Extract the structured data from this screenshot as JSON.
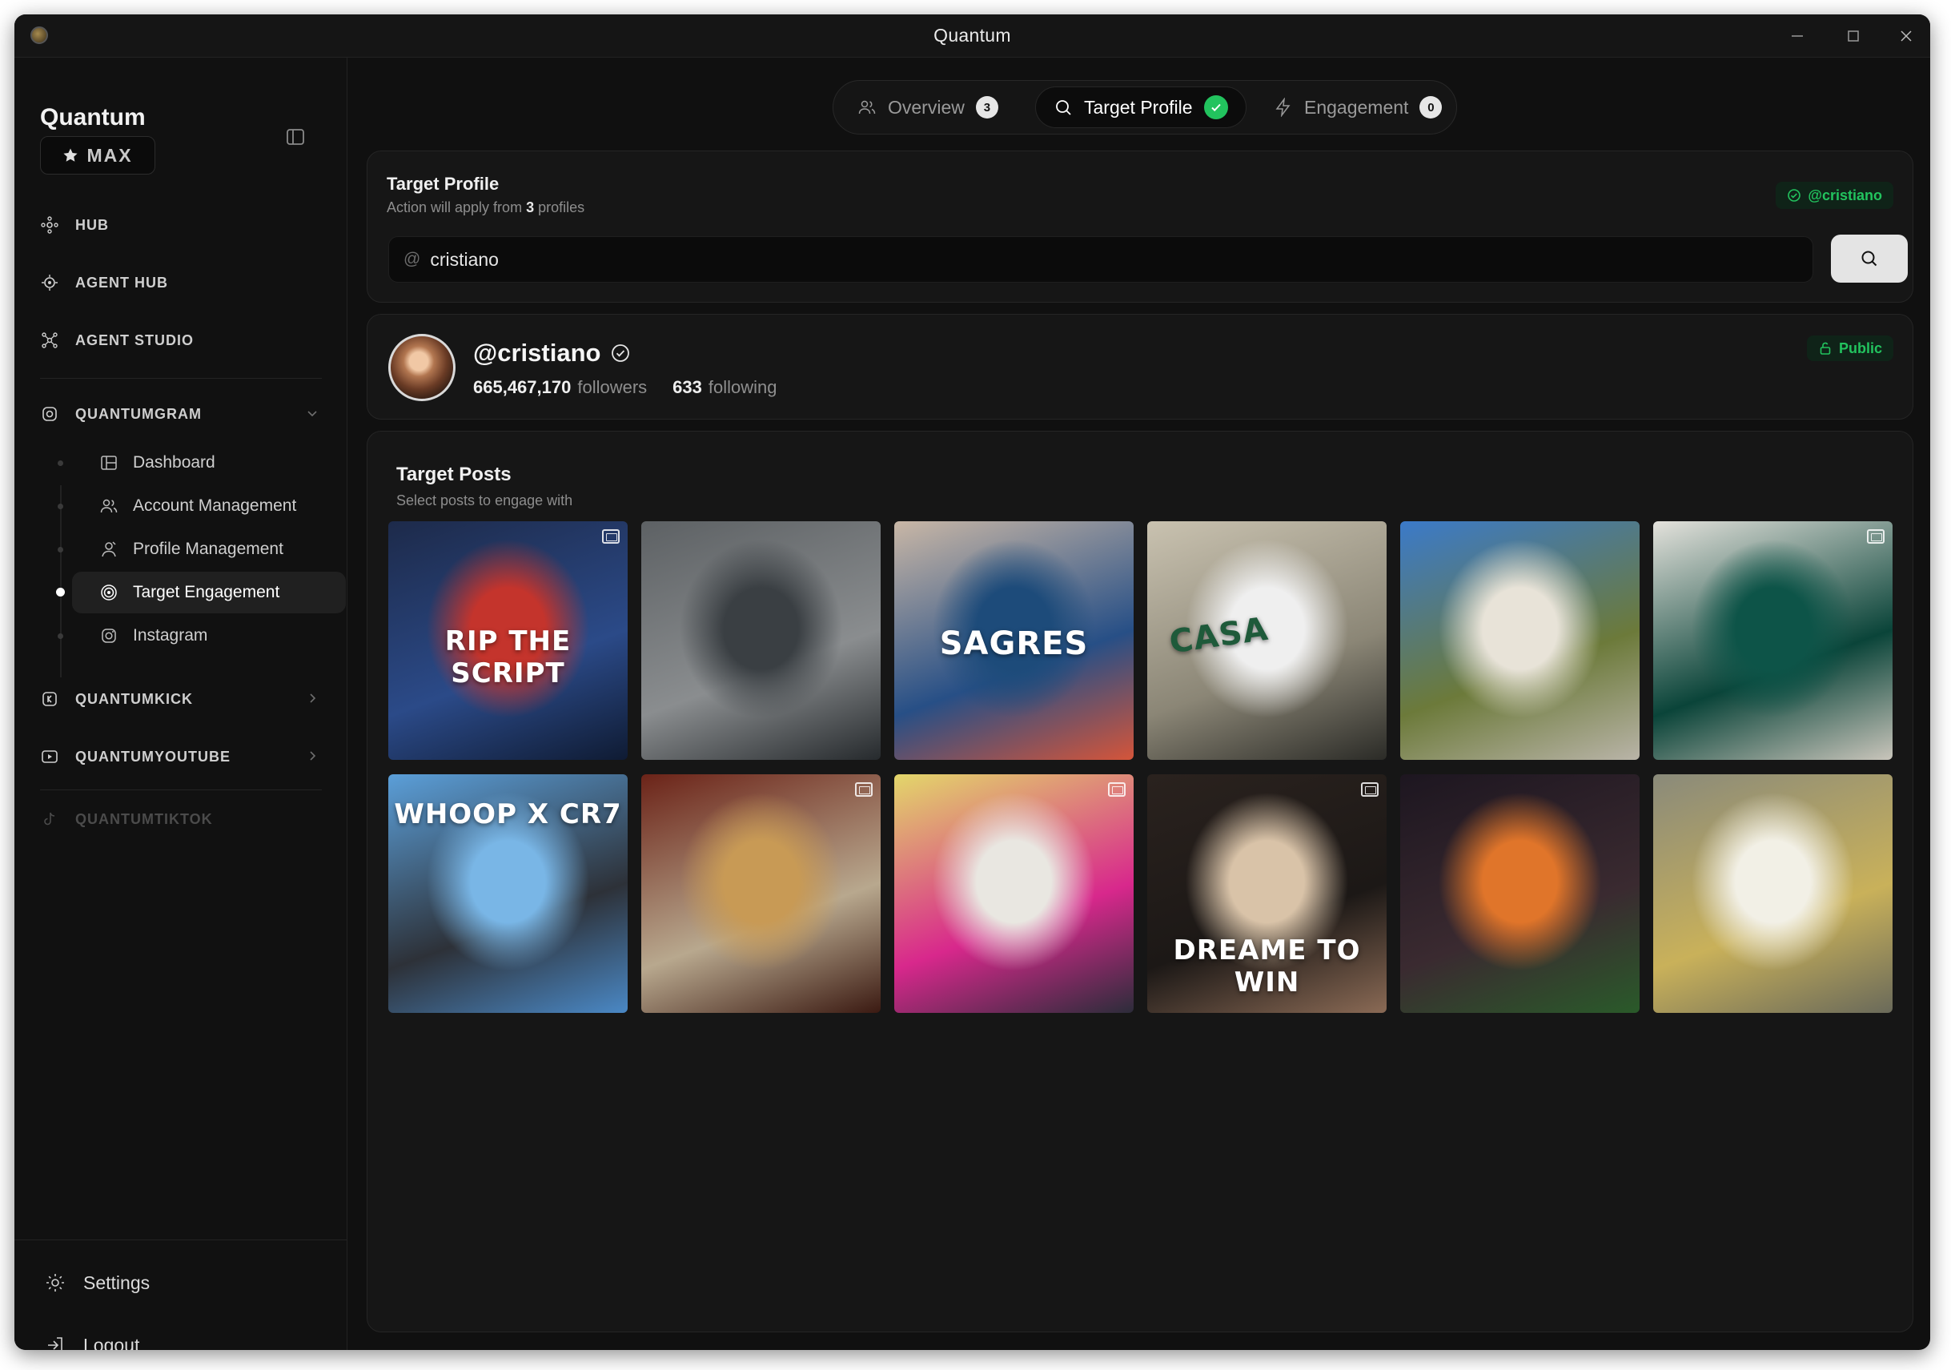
{
  "window": {
    "title": "Quantum"
  },
  "sidebar": {
    "brand": "Quantum",
    "plan": "MAX",
    "nav": [
      {
        "label": "HUB",
        "icon": "hub-icon"
      },
      {
        "label": "AGENT HUB",
        "icon": "agent-hub-icon"
      },
      {
        "label": "AGENT STUDIO",
        "icon": "agent-studio-icon"
      }
    ],
    "quantumgram": {
      "label": "QUANTUMGRAM",
      "items": [
        {
          "label": "Dashboard",
          "icon": "dashboard-icon"
        },
        {
          "label": "Account Management",
          "icon": "users-icon"
        },
        {
          "label": "Profile Management",
          "icon": "profile-icon"
        },
        {
          "label": "Target Engagement",
          "icon": "target-icon",
          "active": true
        },
        {
          "label": "Instagram",
          "icon": "instagram-icon"
        }
      ]
    },
    "sections": [
      {
        "label": "QUANTUMKICK",
        "icon": "kick-icon"
      },
      {
        "label": "QUANTUMYOUTUBE",
        "icon": "youtube-icon"
      },
      {
        "label": "QUANTUMTIKTOK",
        "icon": "tiktok-icon",
        "disabled": true
      }
    ],
    "bottom": [
      {
        "label": "Settings",
        "icon": "gear-icon"
      },
      {
        "label": "Logout",
        "icon": "logout-icon"
      }
    ]
  },
  "tabs": [
    {
      "label": "Overview",
      "icon": "users-icon",
      "count": "3"
    },
    {
      "label": "Target Profile",
      "icon": "search-icon",
      "status": "complete",
      "active": true
    },
    {
      "label": "Engagement",
      "icon": "bolt-icon",
      "count": "0"
    }
  ],
  "target_profile": {
    "title": "Target Profile",
    "subtitle_prefix": "Action will apply from",
    "subtitle_count": "3",
    "subtitle_suffix": "profiles",
    "selected_handle": "@cristiano",
    "search": {
      "prefix": "@",
      "value": "cristiano"
    }
  },
  "profile": {
    "handle": "@cristiano",
    "followers": "665,467,170",
    "followers_label": "followers",
    "following": "633",
    "following_label": "following",
    "visibility": "Public"
  },
  "posts": {
    "title": "Target Posts",
    "subtitle": "Select posts to engage with",
    "items": [
      {
        "overlay": "RIP THE SCRIPT",
        "colors": [
          "#1d2a4a",
          "#c4342c",
          "#2b4a88",
          "#0f1b33"
        ],
        "multi": true
      },
      {
        "overlay": "",
        "colors": [
          "#5d6164",
          "#3a3f43",
          "#8a8d8f",
          "#262a2d"
        ],
        "multi": false
      },
      {
        "overlay": "SAGRES",
        "colors": [
          "#c9b7a6",
          "#1d4b7a",
          "#274f86",
          "#d4553a"
        ],
        "multi": false
      },
      {
        "overlay": "CASA",
        "colors": [
          "#c9c2b0",
          "#efefef",
          "#8b8676",
          "#2b2b27"
        ],
        "multi": false
      },
      {
        "overlay": "",
        "colors": [
          "#3b7ac9",
          "#e8e3d8",
          "#6c7a3a",
          "#b9b4a8"
        ],
        "multi": false
      },
      {
        "overlay": "",
        "colors": [
          "#e4e2dc",
          "#0d5448",
          "#0a4439",
          "#c9c5bb"
        ],
        "multi": true
      },
      {
        "overlay": "WHOOP X CR7",
        "colors": [
          "#5b9fd9",
          "#79b6e6",
          "#2d3138",
          "#4a88c5"
        ],
        "multi": false
      },
      {
        "overlay": "",
        "colors": [
          "#6b2318",
          "#c89a55",
          "#b8a88e",
          "#3b1a12"
        ],
        "multi": true
      },
      {
        "overlay": "",
        "colors": [
          "#e3d76a",
          "#e9e7e1",
          "#d8288c",
          "#2c2c3a"
        ],
        "multi": true
      },
      {
        "overlay": "DREAME TO WIN",
        "colors": [
          "#2a221e",
          "#d9c3a8",
          "#1c1816",
          "#8a6a55"
        ],
        "multi": true
      },
      {
        "overlay": "",
        "colors": [
          "#1d1620",
          "#e0752a",
          "#3a2a30",
          "#2a5a2a"
        ],
        "multi": false
      },
      {
        "overlay": "",
        "colors": [
          "#8a8a7a",
          "#f2f0e6",
          "#c9b15a",
          "#6a6a5a"
        ],
        "multi": false
      }
    ]
  }
}
